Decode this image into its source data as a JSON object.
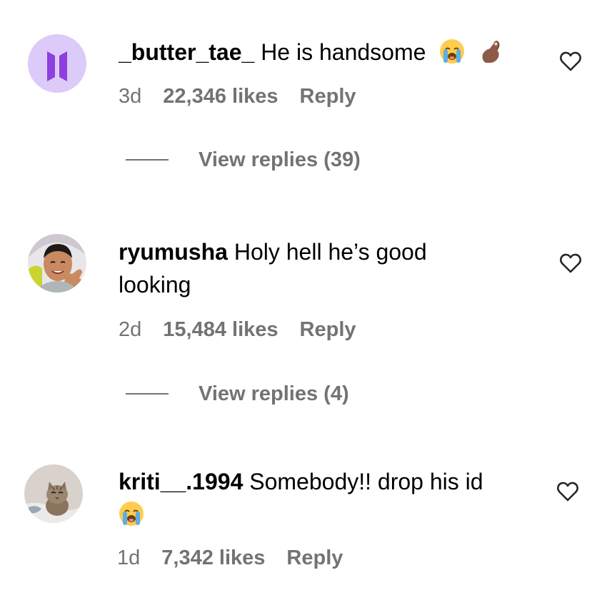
{
  "comments": [
    {
      "username": "_butter_tae_",
      "text": "He is handsome",
      "text_continued": "",
      "emojis": [
        "loudly-crying-face",
        "pinched-fingers"
      ],
      "time": "3d",
      "likes": "22,346 likes",
      "reply_label": "Reply",
      "view_replies": "View replies (39)",
      "avatar": "bts-logo-avatar"
    },
    {
      "username": "ryumusha",
      "text": "Holy hell he’s good",
      "text_continued": "looking",
      "emojis": [],
      "time": "2d",
      "likes": "15,484 likes",
      "reply_label": "Reply",
      "view_replies": "View replies (4)",
      "avatar": "person-photo-avatar"
    },
    {
      "username": "kriti__.1994",
      "text": "Somebody!! drop his id",
      "text_continued": "",
      "emojis": [
        "loudly-crying-face"
      ],
      "time": "1d",
      "likes": "7,342 likes",
      "reply_label": "Reply",
      "view_replies": "",
      "avatar": "kitten-photo-avatar"
    }
  ],
  "colors": {
    "meta_gray": "#737373",
    "text": "#000000",
    "avatar_purple": "#d8c7f7",
    "bts_logo": "#8f3ee0"
  }
}
